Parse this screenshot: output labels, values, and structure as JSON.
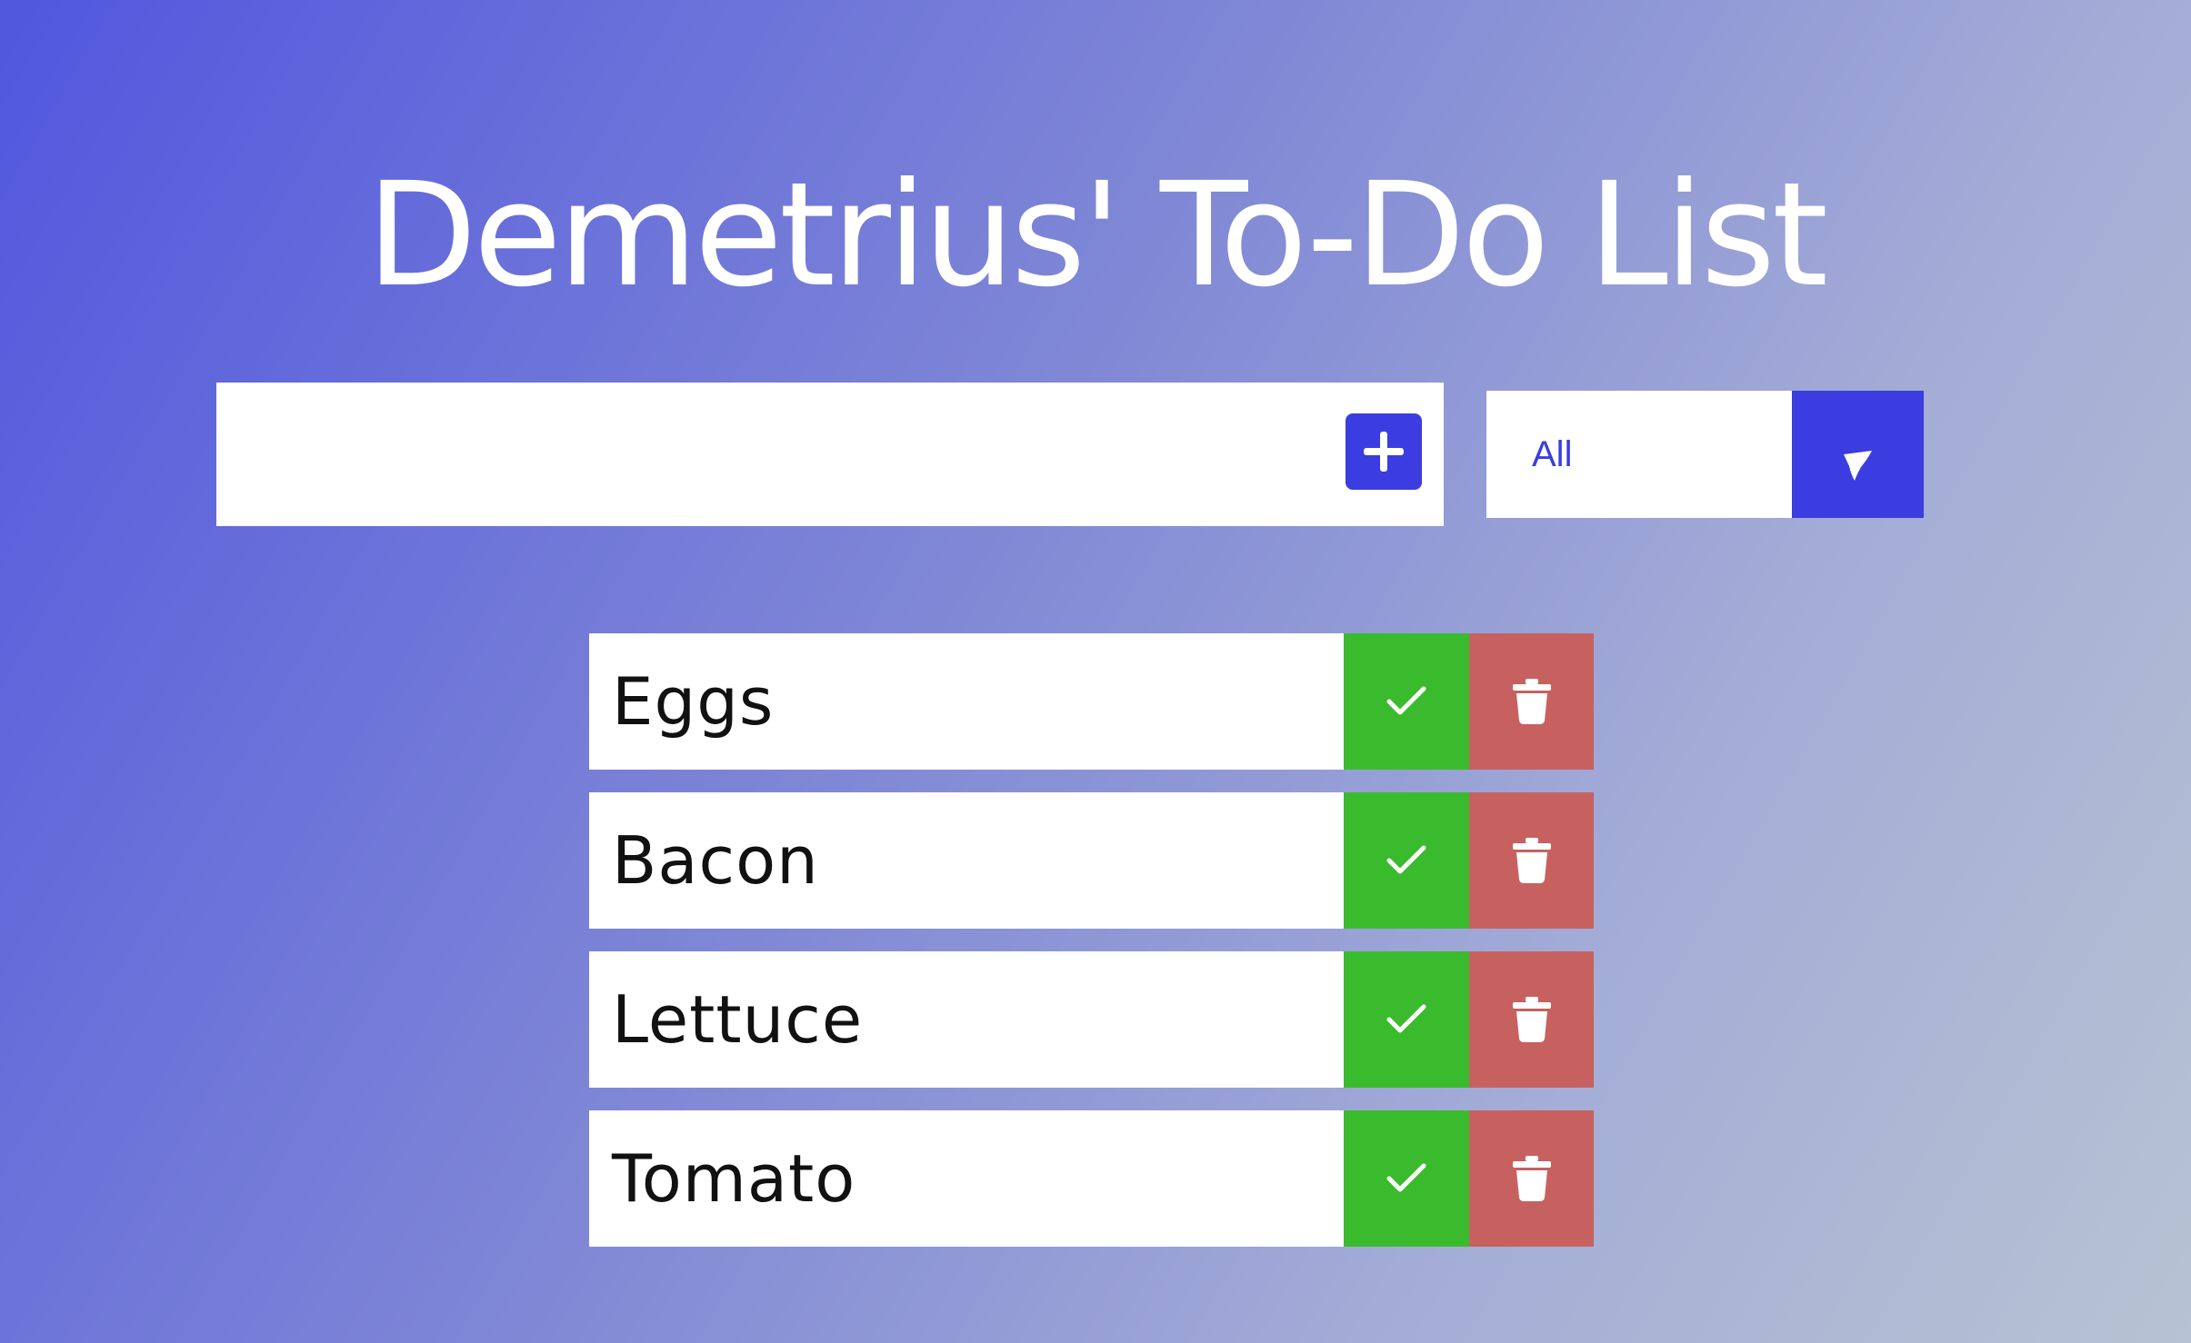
{
  "header": {
    "title": "Demetrius' To-Do List"
  },
  "form": {
    "input_value": "",
    "input_placeholder": "",
    "add_icon": "plus-icon"
  },
  "filter": {
    "selected": "All",
    "arrow_icon": "chevron-down-icon"
  },
  "todos": [
    {
      "text": "Eggs"
    },
    {
      "text": "Bacon"
    },
    {
      "text": "Lettuce"
    },
    {
      "text": "Tomato"
    }
  ],
  "item_actions": {
    "complete_icon": "check-icon",
    "delete_icon": "trash-icon"
  },
  "colors": {
    "accent": "#3b3de0",
    "complete": "#3abb2d",
    "delete": "#c76160",
    "gradient_start": "#5157de",
    "gradient_end": "#b6c3d3"
  }
}
